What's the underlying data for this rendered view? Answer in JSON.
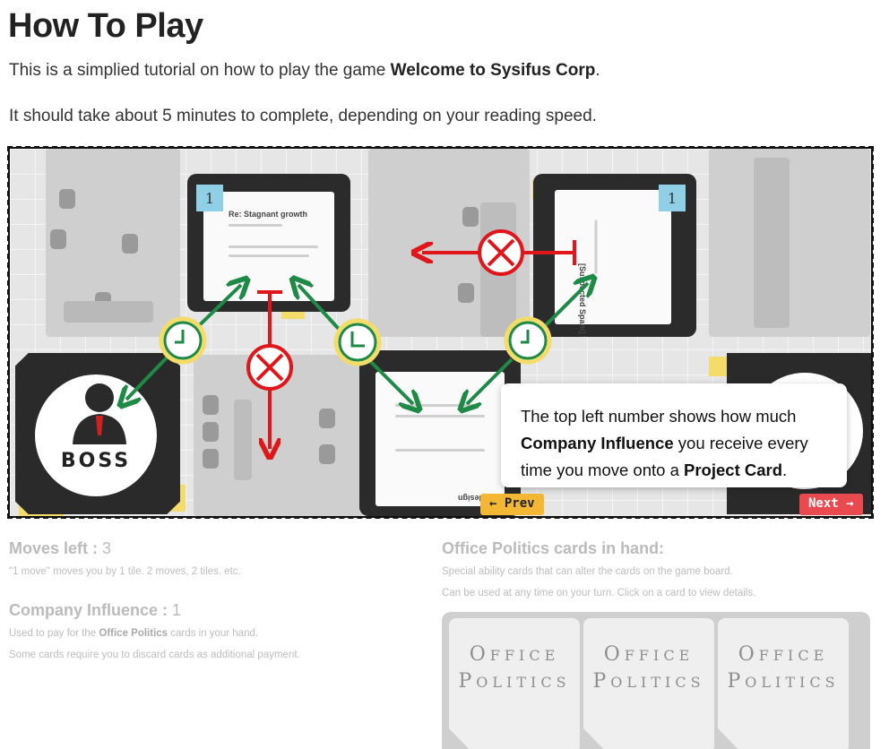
{
  "page": {
    "title": "How To Play",
    "intro_prefix": "This is a simplied tutorial on how to play the game ",
    "intro_game": "Welcome to Sysifus Corp",
    "intro_suffix": ".",
    "duration": "It should take about 5 minutes to complete, depending on your reading speed."
  },
  "board": {
    "boss_label": "BOSS",
    "cards": [
      {
        "number": "1",
        "subject": "Re: Stagnant growth"
      },
      {
        "number": "1",
        "subject": "[Suspected Spam] Why are..."
      },
      {
        "number": "",
        "subject": "Re: Site design"
      }
    ],
    "tooltip": {
      "part1": "The top left number shows how much ",
      "bold1": "Company Influence",
      "part2": " you receive every time you move onto a ",
      "bold2": "Project Card",
      "part3": "."
    },
    "prev_label": "← Prev",
    "next_label": "Next →",
    "colors": {
      "allowed": "#1f8a46",
      "blocked": "#e0161b",
      "prev": "#f3b733",
      "next": "#e84a4f"
    }
  },
  "stats": {
    "moves_label": "Moves left : ",
    "moves_value": "3",
    "moves_note": "\"1 move\" moves you by 1 tile. 2 moves, 2 tiles. etc.",
    "influence_label": "Company Influence : ",
    "influence_value": "1",
    "influence_note_prefix": "Used to pay for the ",
    "influence_note_bold": "Office Politics",
    "influence_note_suffix": " cards in your hand.",
    "influence_note2": "Some cards require you to discard cards as additional payment."
  },
  "hand": {
    "title": "Office Politics cards in hand:",
    "note1": "Special ability cards that can alter the cards on the game board.",
    "note2": "Can be used at any time on your turn. Click on a card to view details.",
    "cards": [
      {
        "line1_cap": "O",
        "line1_rest": "FFICE",
        "line2_cap": "P",
        "line2_rest": "OLITICS"
      },
      {
        "line1_cap": "O",
        "line1_rest": "FFICE",
        "line2_cap": "P",
        "line2_rest": "OLITICS"
      },
      {
        "line1_cap": "O",
        "line1_rest": "FFICE",
        "line2_cap": "P",
        "line2_rest": "OLITICS"
      }
    ]
  }
}
